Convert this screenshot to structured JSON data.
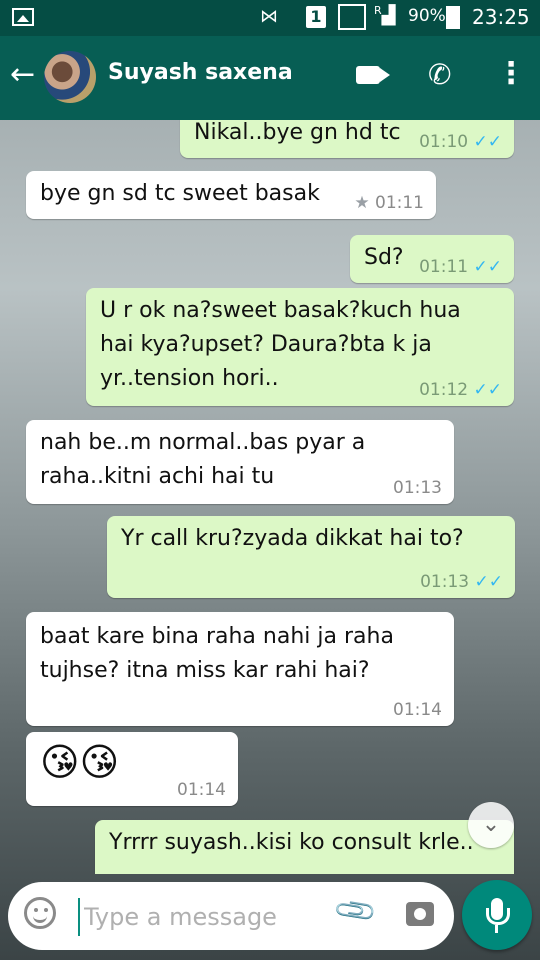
{
  "status_bar": {
    "sim_slot": "1",
    "network_label": "R",
    "battery": "90%",
    "time": "23:25",
    "icons": [
      "image-icon",
      "vibrate-icon",
      "sim-icon",
      "signal-icon",
      "signal-roaming-icon",
      "battery-charging-icon"
    ]
  },
  "header": {
    "contact_name": "Suyash saxena",
    "icons": [
      "back-arrow-icon",
      "avatar",
      "video-call-icon",
      "voice-call-icon",
      "more-menu-icon"
    ]
  },
  "messages": [
    {
      "direction": "outgoing",
      "text": "Nikal..bye gn hd tc",
      "time": "01:10",
      "status": "✓✓"
    },
    {
      "direction": "incoming",
      "text": "bye gn sd tc sweet basak",
      "time": "01:11",
      "starred": true
    },
    {
      "direction": "outgoing",
      "text": "Sd?",
      "time": "01:11",
      "status": "✓✓"
    },
    {
      "direction": "outgoing",
      "lines": [
        "U r ok na?sweet basak?kuch hua",
        "hai kya?upset? Daura?bta k ja",
        "yr..tension hori.."
      ],
      "time": "01:12",
      "status": "✓✓"
    },
    {
      "direction": "incoming",
      "lines": [
        "nah be..m normal..bas pyar a",
        "raha..kitni achi hai tu"
      ],
      "time": "01:13"
    },
    {
      "direction": "outgoing",
      "text": "Yr call kru?zyada dikkat hai to?",
      "time": "01:13",
      "status": "✓✓"
    },
    {
      "direction": "incoming",
      "lines": [
        "baat kare bina raha nahi ja raha",
        "tujhse? itna miss kar rahi hai?"
      ],
      "time": "01:14"
    },
    {
      "direction": "incoming",
      "text": "😘😘",
      "time": "01:14"
    },
    {
      "direction": "outgoing",
      "text": "Yrrrr suyash..kisi ko consult krle.."
    }
  ],
  "composer": {
    "placeholder": "Type a message",
    "value": ""
  },
  "colors": {
    "status_bar": "#054d44",
    "app_bar": "#075e54",
    "outgoing_bubble": "#dcf8c6",
    "incoming_bubble": "#ffffff",
    "read_ticks": "#34b7f1",
    "mic_button": "#00897b"
  }
}
